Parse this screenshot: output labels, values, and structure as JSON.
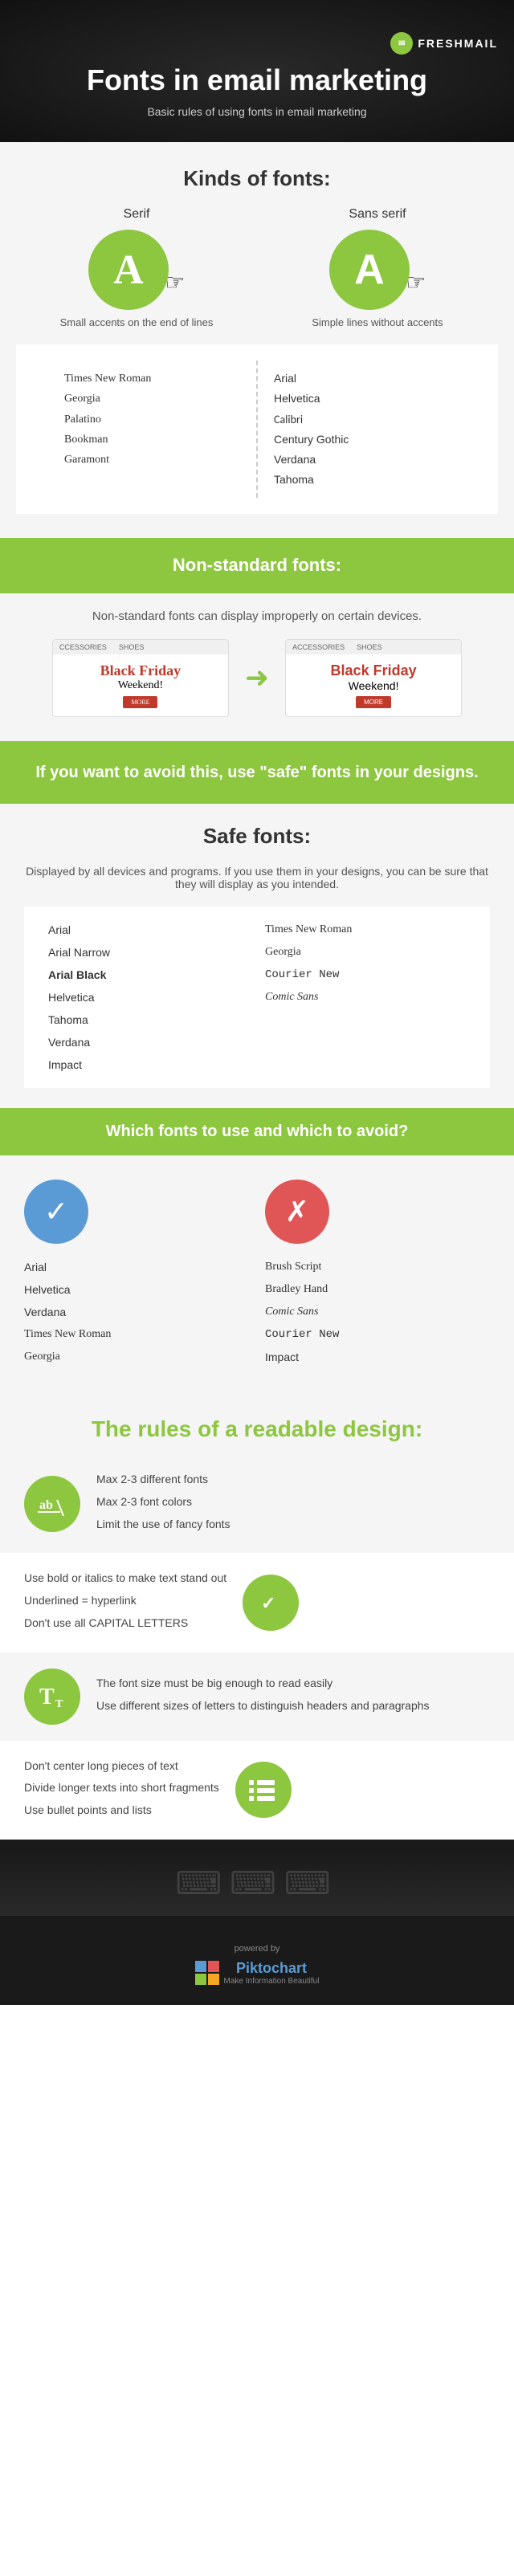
{
  "header": {
    "logo": "FRESHMAIL",
    "title": "Fonts in email marketing",
    "subtitle": "Basic rules of using fonts in email marketing"
  },
  "kinds": {
    "section_title": "Kinds of fonts:",
    "serif": {
      "label": "Serif",
      "letter": "A",
      "description": "Small accents on the end of lines"
    },
    "sans": {
      "label": "Sans serif",
      "letter": "A",
      "description": "Simple lines without accents"
    },
    "serif_fonts": [
      "Times New Roman",
      "Georgia",
      "Palatino",
      "Bookman",
      "Garamont"
    ],
    "sans_fonts": [
      "Arial",
      "Helvetica",
      "Calibri",
      "Century Gothic",
      "Verdana",
      "Tahoma"
    ]
  },
  "nonstandard": {
    "banner_title": "Non-standard fonts:",
    "description": "Non-standard fonts can display improperly on certain devices.",
    "email1": {
      "tab1": "CCESSORIES",
      "tab2": "SHOES",
      "title": "Black Friday",
      "sub": "Weekend!",
      "btn": "MORE"
    },
    "email2": {
      "tab1": "ACCESSORIES",
      "tab2": "SHOES",
      "title": "Black Friday",
      "sub": "Weekend!",
      "btn": "MORE"
    }
  },
  "avoid": {
    "banner_text": "If you want to avoid this, use \"safe\" fonts in your designs."
  },
  "safe": {
    "section_title": "Safe fonts:",
    "description": "Displayed by all devices and programs. If you use them in your designs, you can be sure that they will display as you intended.",
    "col1": [
      "Arial",
      "Arial Narrow",
      "Arial Black",
      "Helvetica",
      "Tahoma",
      "Verdana",
      "Impact"
    ],
    "col2": [
      "Times New Roman",
      "Georgia",
      "Courier New",
      "Comic Sans"
    ]
  },
  "which": {
    "banner_text": "Which fonts to use and which to avoid?",
    "good_fonts": [
      "Arial",
      "Helvetica",
      "Verdana",
      "Times New Roman",
      "Georgia"
    ],
    "bad_fonts": [
      "Brush Script",
      "Bradley Hand",
      "Comic Sans",
      "Courier New",
      "Impact"
    ]
  },
  "rules": {
    "section_title": "The rules of a readable design:",
    "card1": {
      "icon": "ab/",
      "points": [
        "Max 2-3 different fonts",
        "Max 2-3 font colors",
        "Limit the use of fancy fonts"
      ]
    },
    "card2": {
      "icon": "✓",
      "points": [
        "Use bold or italics to make text stand out",
        "Underlined = hyperlink",
        "Don't use all CAPITAL LETTERS"
      ]
    },
    "card3": {
      "icon": "T",
      "points": [
        "The font size must be big enough to read easily",
        "Use different sizes of letters to distinguish headers and paragraphs"
      ]
    },
    "card4": {
      "icon": "≡",
      "points": [
        "Don't center long pieces of text",
        "Divide longer texts into short fragments",
        "Use bullet points and lists"
      ]
    }
  },
  "footer": {
    "powered_by": "powered by",
    "brand": "Piktochart",
    "tagline": "Make Information Beautiful"
  }
}
